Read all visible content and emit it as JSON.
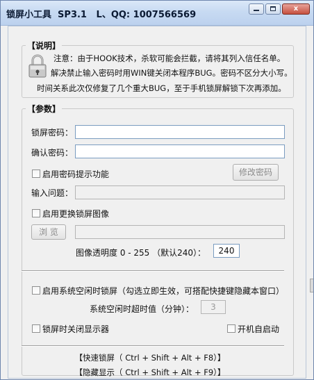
{
  "window": {
    "title": "锁屏小工具  SP3.1   L、QQ: 1007566569",
    "minimize_label": "",
    "maximize_label": "",
    "close_label": "x"
  },
  "notice": {
    "heading": "【说明】",
    "icon": "lock-icon",
    "lines": [
      "注意：由于HOOK技术，杀软可能会拦截，请将其列入信任名单。",
      "解决禁止输入密码时用WIN键关闭本程序BUG。密码不区分大小写。",
      "时间关系此次仅修复了几个重大BUG，至于手机锁屏解锁下次再添加。"
    ]
  },
  "params": {
    "heading": "【参数】",
    "lock_password_label": "锁屏密码：",
    "lock_password_value": "",
    "confirm_password_label": "确认密码：",
    "confirm_password_value": "",
    "enable_hint_label": "启用密码提示功能",
    "enable_hint_checked": false,
    "change_password_button": "修改密码",
    "hint_question_label": "输入问题：",
    "hint_question_value": "",
    "enable_image_label": "启用更换锁屏图像",
    "enable_image_checked": false,
    "browse_button": "浏 览",
    "image_path_value": "",
    "opacity_label": "图像透明度 0 - 255 （默认240）：",
    "opacity_value": "240",
    "idle_lock_label": "启用系统空闲时锁屏（勾选立即生效，可搭配快捷键隐藏本窗口）",
    "idle_lock_checked": false,
    "idle_timeout_label": "系统空闲时超时值（分钟）：",
    "idle_timeout_value": "3",
    "monitor_off_label": "锁屏时关闭显示器",
    "monitor_off_checked": false,
    "autostart_label": "开机自启动",
    "autostart_checked": false
  },
  "hotkeys": {
    "quick_lock": "【快速锁屏（ Ctrl + Shift + Alt + F8）】",
    "hide_show": "【隐藏显示（ Ctrl + Shift + Alt + F9）】"
  },
  "colors": {
    "title_gradient_top": "#dbe8f8",
    "title_gradient_bottom": "#bcd1ee",
    "window_bg": "#f0f0f0",
    "close_button": "#c6503f"
  }
}
